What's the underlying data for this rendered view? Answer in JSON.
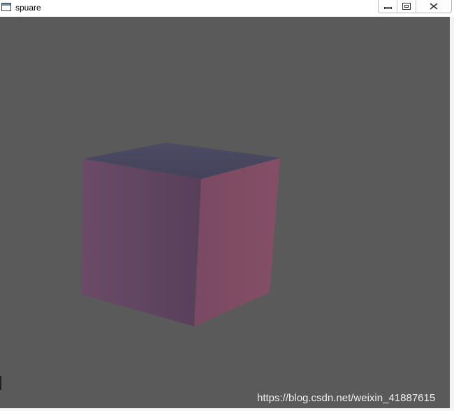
{
  "window": {
    "title": "spuare",
    "controls": {
      "minimize_icon": "minimize-icon",
      "restore_icon": "restore-icon",
      "close_icon": "close-icon"
    }
  },
  "watermark": "https://blog.csdn.net/weixin_41887615",
  "colors": {
    "background": "#5a5a5a",
    "cube_top": "#4a4860",
    "cube_front": "#5e4460",
    "cube_right": "#7c4b63"
  }
}
